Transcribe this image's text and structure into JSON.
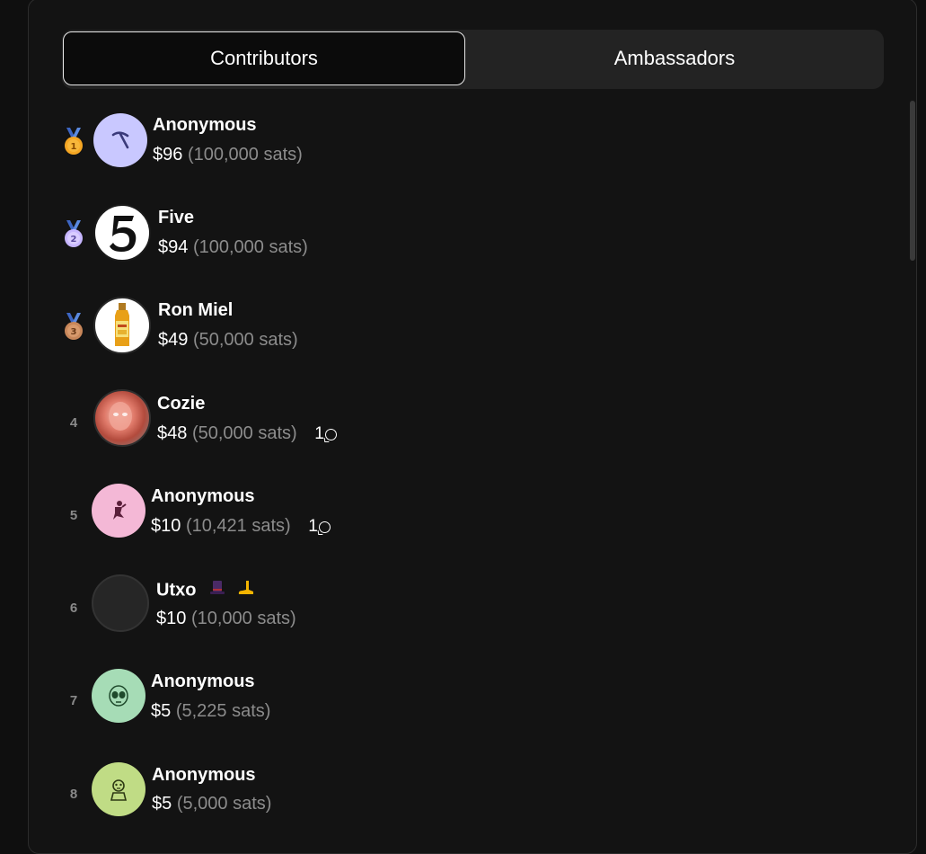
{
  "tabs": [
    {
      "label": "Contributors",
      "active": true
    },
    {
      "label": "Ambassadors",
      "active": false
    }
  ],
  "contributors": [
    {
      "rank": "1",
      "medal": "gold",
      "name": "Anonymous",
      "usd": "$96",
      "sats": "(100,000 sats)",
      "comments": null,
      "avatar": "pickaxe-icon",
      "avatar_bg": "#c9c8ff"
    },
    {
      "rank": "2",
      "medal": "silver",
      "name": "Five",
      "usd": "$94",
      "sats": "(100,000 sats)",
      "comments": null,
      "avatar": "five-logo",
      "avatar_bg": "#ffffff"
    },
    {
      "rank": "3",
      "medal": "bronze",
      "name": "Ron Miel",
      "usd": "$49",
      "sats": "(50,000 sats)",
      "comments": null,
      "avatar": "honey-rum-bottle",
      "avatar_bg": "#ffffff"
    },
    {
      "rank": "4",
      "medal": null,
      "name": "Cozie",
      "usd": "$48",
      "sats": "(50,000 sats)",
      "comments": "1",
      "avatar": "person-photo",
      "avatar_bg": "#d98a7a"
    },
    {
      "rank": "5",
      "medal": null,
      "name": "Anonymous",
      "usd": "$10",
      "sats": "(10,421 sats)",
      "comments": "1",
      "avatar": "dancer-icon",
      "avatar_bg": "#f4b8d6"
    },
    {
      "rank": "6",
      "medal": null,
      "name": "Utxo",
      "usd": "$10",
      "sats": "(10,000 sats)",
      "comments": null,
      "avatar": "blank-avatar",
      "avatar_bg": "#262626",
      "badges": [
        "top-hat-icon",
        "leg-icon"
      ]
    },
    {
      "rank": "7",
      "medal": null,
      "name": "Anonymous",
      "usd": "$5",
      "sats": "(5,225 sats)",
      "comments": null,
      "avatar": "alien-icon",
      "avatar_bg": "#a6dcb6"
    },
    {
      "rank": "8",
      "medal": null,
      "name": "Anonymous",
      "usd": "$5",
      "sats": "(5,000 sats)",
      "comments": null,
      "avatar": "zombie-icon",
      "avatar_bg": "#c0dc85"
    }
  ],
  "colors": {
    "background": "#0f0f0f",
    "panel": "#131313",
    "muted": "#8c8c8c",
    "gold": "#f5a623",
    "silver": "#c7b6ff",
    "bronze": "#c8875a"
  }
}
